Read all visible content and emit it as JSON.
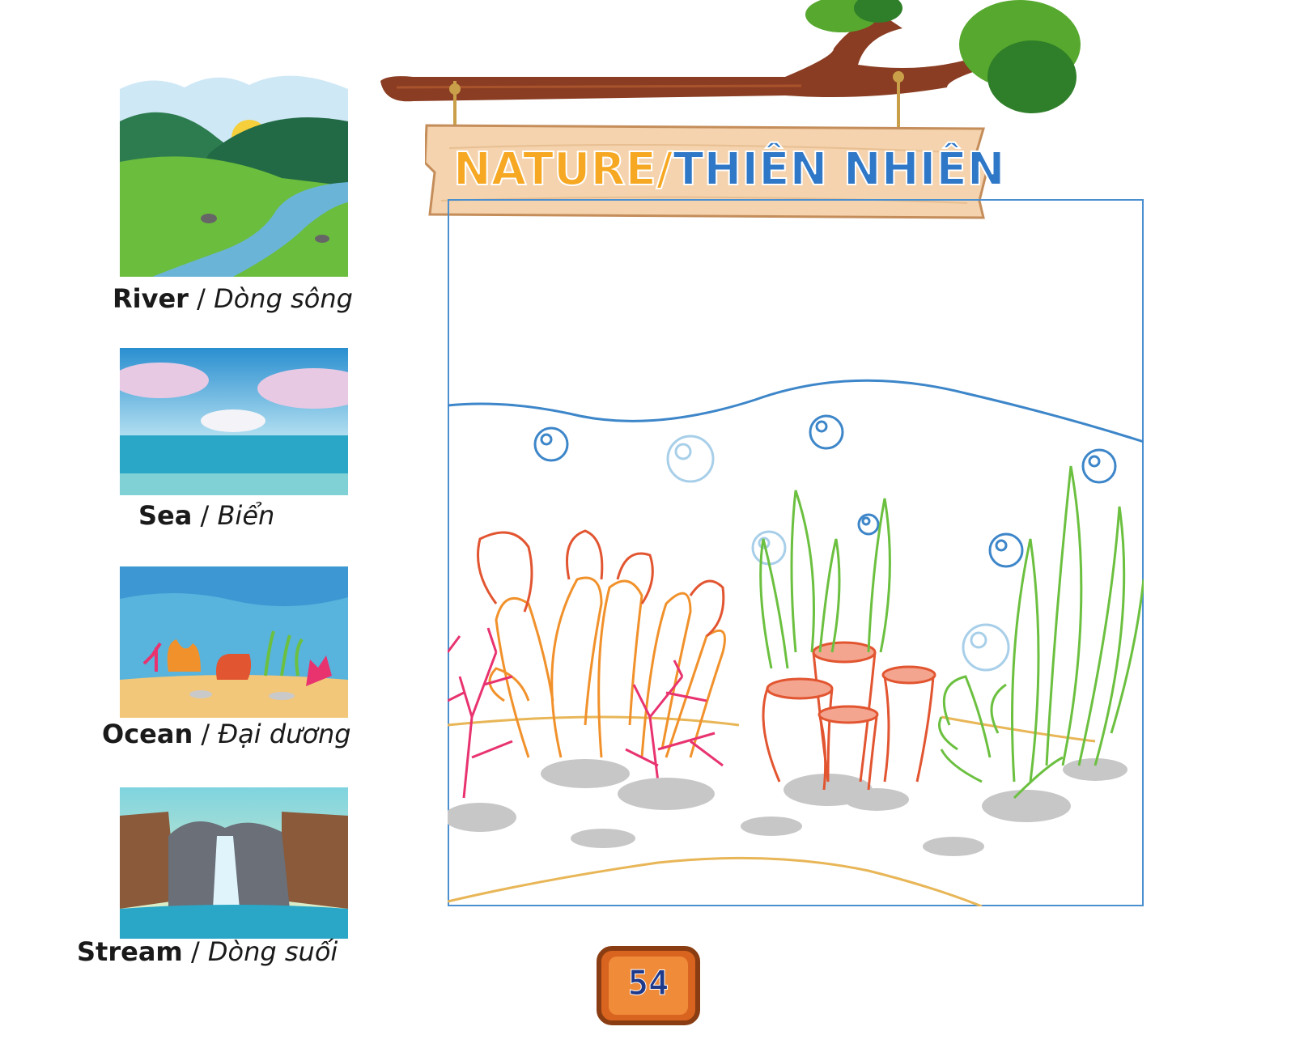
{
  "header": {
    "title_part1": "NATURE/",
    "title_part2": "THIÊN NHIÊN"
  },
  "vocabulary": [
    {
      "english": "River",
      "separator": " / ",
      "vietnamese": "Dòng sông",
      "image_icon": "river-landscape-illustration"
    },
    {
      "english": "Sea",
      "separator": " / ",
      "vietnamese": "Biển",
      "image_icon": "sea-landscape-illustration"
    },
    {
      "english": "Ocean",
      "separator": " / ",
      "vietnamese": "Đại dương",
      "image_icon": "ocean-reef-illustration"
    },
    {
      "english": "Stream",
      "separator": " / ",
      "vietnamese": "Dòng suối",
      "image_icon": "waterfall-stream-illustration"
    }
  ],
  "coloring_scene": {
    "subject": "underwater coral reef outline",
    "colors": {
      "frame": "#4a8fd0",
      "water_line": "#3d86c9",
      "sand_line": "#e8b657",
      "coral_orange": "#f1912b",
      "coral_red": "#e25531",
      "coral_pink": "#e8336f",
      "seaweed": "#6cc040",
      "bubble": "#3d86c9",
      "rock": "#c7c7c7"
    }
  },
  "footer": {
    "page_number": "54"
  }
}
